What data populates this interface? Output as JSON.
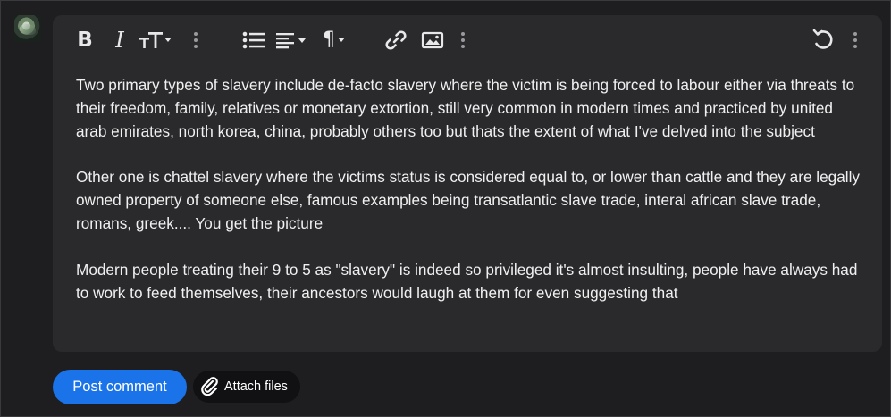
{
  "avatar": {
    "icon": "user-avatar-icon"
  },
  "toolbar": {
    "bold": {
      "glyph": "B",
      "icon": "bold-icon"
    },
    "italic": {
      "glyph": "I",
      "icon": "italic-icon"
    },
    "text_size": {
      "icon": "text-size-icon"
    },
    "more_1": {
      "icon": "more-vertical-icon"
    },
    "bullet_list": {
      "icon": "bullet-list-icon"
    },
    "align": {
      "icon": "align-left-icon"
    },
    "paragraph": {
      "glyph": "¶",
      "icon": "paragraph-icon"
    },
    "link": {
      "icon": "link-icon"
    },
    "image": {
      "icon": "image-icon"
    },
    "more_2": {
      "icon": "more-vertical-icon"
    },
    "undo": {
      "icon": "undo-icon"
    },
    "more_3": {
      "icon": "more-vertical-icon"
    }
  },
  "content": {
    "paragraphs": [
      "Two primary types of slavery include de-facto slavery where the victim is being forced to labour either via threats to their freedom, family, relatives or monetary extortion, still very common in modern times and practiced by united arab emirates, north korea, china, probably others too but thats the extent of what I've delved into the subject",
      "Other one is chattel slavery where the victims status is considered equal to, or lower than cattle and they are legally owned property of someone else, famous examples being transatlantic slave trade, interal african slave trade, romans, greek.... You get the picture",
      "Modern people treating their 9 to 5 as \"slavery\" is indeed so privileged it's almost insulting, people have always had to work to feed themselves, their ancestors would laugh at them for even suggesting that"
    ]
  },
  "actions": {
    "post_label": "Post comment",
    "attach_label": "Attach files",
    "attach_icon": "paperclip-icon"
  },
  "colors": {
    "accent": "#1a73e8",
    "editor_bg": "#2a2a2d",
    "page_bg": "#1e1e20"
  }
}
